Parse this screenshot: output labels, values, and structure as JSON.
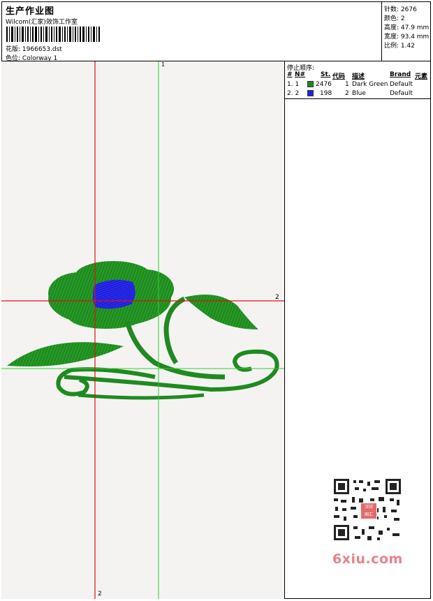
{
  "header": {
    "title": "生产作业图",
    "studio": "Wilcom(汇家)效饰工作室",
    "design_label": "花版:",
    "design_value": "1966653.dst",
    "color_label": "色位:",
    "color_value": "Colorway 1"
  },
  "stats": {
    "stitches": "针数: 2676",
    "colors": "颜色: 2",
    "height": "高度: 47.9 mm",
    "width": "宽度: 93.4 mm",
    "scale": "比例: 1.42"
  },
  "canvas": {
    "guide_top_label": "1",
    "guide_right_label": "2",
    "guide_bottom_label": "2"
  },
  "stop_sequence": {
    "title": "停止顺序:",
    "columns": [
      "#",
      "N#",
      "St.",
      "代码",
      "描述",
      "Brand",
      "元素"
    ],
    "rows": [
      {
        "idx": "1. 1",
        "st": "2476",
        "code": "1",
        "desc": "Dark Green",
        "brand": "Default",
        "color": "#1a8a1a"
      },
      {
        "idx": "2. 2",
        "st": "198",
        "code": "2",
        "desc": "Blue",
        "brand": "Default",
        "color": "#1f1fe0"
      }
    ]
  },
  "watermark": {
    "text": "6xiu.com",
    "seal_text": "汉印 图汇"
  }
}
